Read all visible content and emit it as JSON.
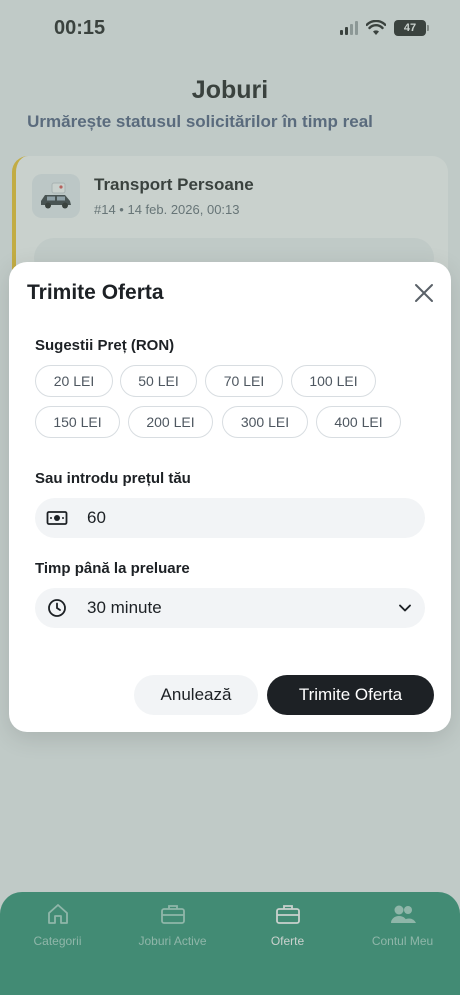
{
  "status_bar": {
    "time": "00:15",
    "battery": "47"
  },
  "page": {
    "title": "Joburi",
    "subtitle": "Urmărește statusul solicitărilor în timp real"
  },
  "job_card": {
    "title": "Transport Persoane",
    "meta": "#14 • 14 feb. 2026, 00:13",
    "accent_color": "#f4c21b"
  },
  "modal": {
    "title": "Trimite Oferta",
    "price_suggestions_label": "Sugestii Preț (RON)",
    "price_chips": [
      "20 LEI",
      "50 LEI",
      "70 LEI",
      "100 LEI",
      "150 LEI",
      "200 LEI",
      "300 LEI",
      "400 LEI"
    ],
    "custom_price_label": "Sau introdu prețul tău",
    "custom_price_value": "60",
    "pickup_time_label": "Timp până la preluare",
    "pickup_time_value": "30 minute",
    "cancel_label": "Anulează",
    "submit_label": "Trimite Oferta",
    "icons": {
      "close": "close-icon",
      "money": "cash-icon",
      "clock": "clock-icon",
      "dropdown": "chevron-down-icon"
    }
  },
  "bottom_nav": {
    "background": "#1f8a6c",
    "items": [
      {
        "label": "Categorii",
        "icon": "home-icon",
        "active": false
      },
      {
        "label": "Joburi Active",
        "icon": "briefcase-icon",
        "active": false
      },
      {
        "label": "Oferte",
        "icon": "briefcase-icon",
        "active": true
      },
      {
        "label": "Contul Meu",
        "icon": "users-icon",
        "active": false
      }
    ]
  }
}
